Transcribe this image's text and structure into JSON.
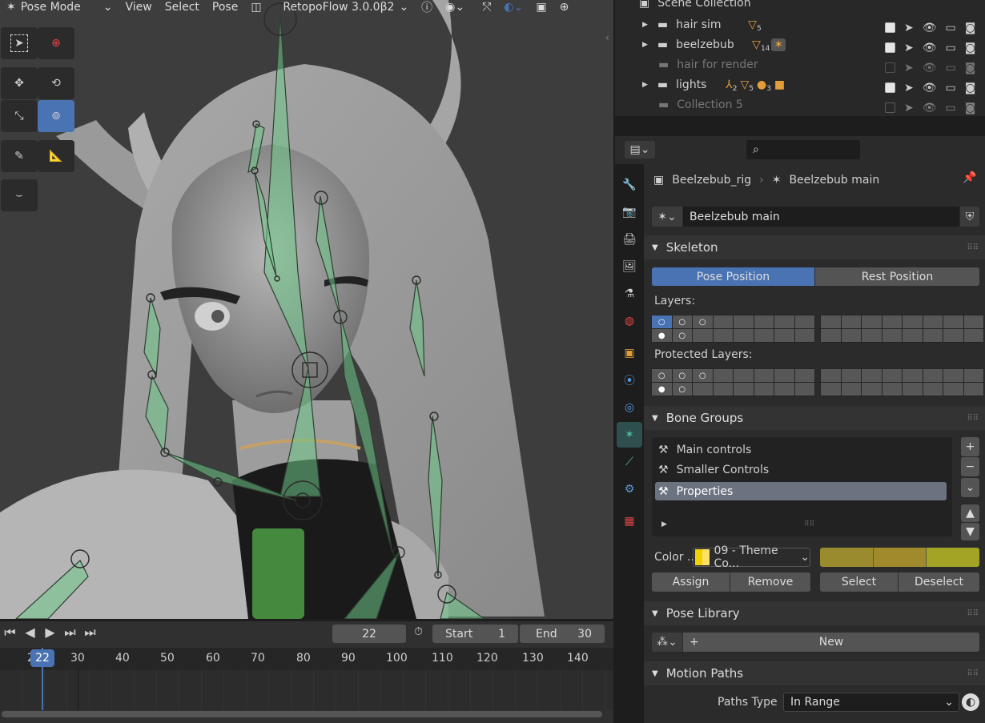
{
  "header": {
    "mode": "Pose Mode",
    "menus": [
      "View",
      "Select",
      "Pose"
    ],
    "addon": "RetopoFlow 3.0.0β2"
  },
  "outliner": {
    "title": "Scene Collection",
    "items": [
      {
        "name": "hair sim",
        "badge": "5",
        "checked": true
      },
      {
        "name": "beelzebub",
        "badge": "14",
        "checked": true
      },
      {
        "name": "hair for render",
        "checked": false
      },
      {
        "name": "lights",
        "badges": [
          "2",
          "5",
          "3"
        ],
        "checked": true
      },
      {
        "name": "Collection 5",
        "checked": false
      }
    ]
  },
  "properties": {
    "breadcrumb_object": "Beelzebub_rig",
    "breadcrumb_data": "Beelzebub main",
    "armature_name": "Beelzebub main",
    "skeleton": {
      "title": "Skeleton",
      "pose_position": "Pose Position",
      "rest_position": "Rest Position",
      "layers_label": "Layers:",
      "protected_layers_label": "Protected Layers:"
    },
    "bone_groups": {
      "title": "Bone Groups",
      "items": [
        "Main controls",
        "Smaller Controls",
        "Properties"
      ],
      "selected": "Properties",
      "color_label": "Color ...",
      "color_value": "09 - Theme Co...",
      "swatches": [
        "#9a8c2e",
        "#a08a2c",
        "#a3a325"
      ],
      "assign": "Assign",
      "remove": "Remove",
      "select": "Select",
      "deselect": "Deselect"
    },
    "pose_library": {
      "title": "Pose Library",
      "new_label": "New"
    },
    "motion_paths": {
      "title": "Motion Paths",
      "paths_type_label": "Paths Type",
      "paths_type_value": "In Range"
    }
  },
  "timeline": {
    "current_frame": "22",
    "start_label": "Start",
    "start_value": "1",
    "end_label": "End",
    "end_value": "30",
    "ruler": [
      "2",
      "22",
      "30",
      "40",
      "50",
      "60",
      "70",
      "80",
      "90",
      "100",
      "110",
      "120",
      "130",
      "140"
    ]
  },
  "colors": {
    "accent": "#4a73b3",
    "bone_green": "#6ec98a"
  }
}
